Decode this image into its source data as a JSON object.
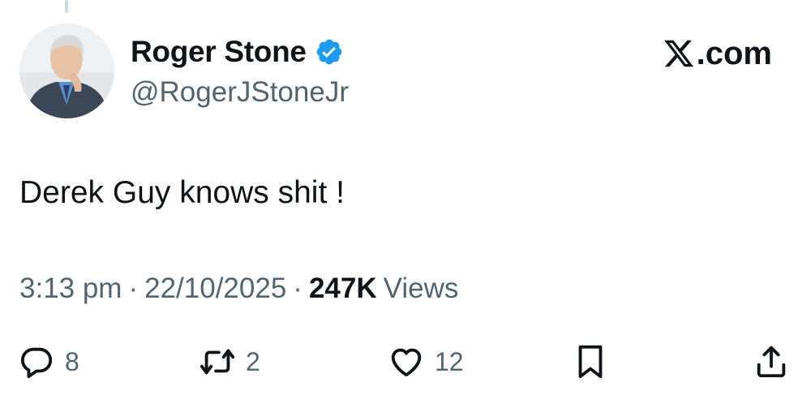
{
  "author": {
    "display_name": "Roger Stone",
    "handle": "@RogerJStoneJr",
    "verified": true,
    "verified_color": "#1d9bf0",
    "avatar_icon": "profile-photo"
  },
  "brand": {
    "logo_icon": "x-logo-icon",
    "suffix": ".com"
  },
  "tweet": {
    "text": "Derek Guy knows shit !"
  },
  "meta": {
    "time": "3:13 pm",
    "separator": "·",
    "date": "22/10/2025",
    "views_count": "247K",
    "views_label": "Views"
  },
  "actions": {
    "reply": {
      "icon": "reply-icon",
      "count": "8"
    },
    "repost": {
      "icon": "repost-icon",
      "count": "2"
    },
    "like": {
      "icon": "heart-icon",
      "count": "12"
    },
    "bookmark": {
      "icon": "bookmark-icon"
    },
    "share": {
      "icon": "share-icon"
    }
  },
  "colors": {
    "text_primary": "#0f1419",
    "text_secondary": "#536471",
    "accent": "#1d9bf0"
  }
}
